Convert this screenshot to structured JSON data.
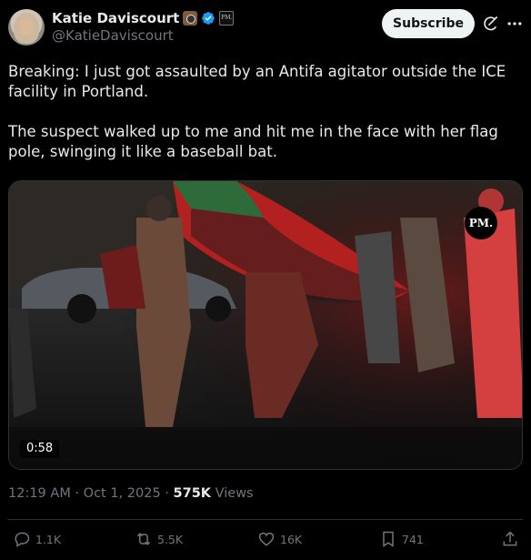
{
  "author": {
    "display_name": "Katie Daviscourt",
    "handle": "@KatieDaviscourt",
    "badges": [
      "camera-emoji-icon",
      "verified-icon",
      "pm-affiliate-icon"
    ],
    "affiliate_badge_text": "PM."
  },
  "header": {
    "subscribe_label": "Subscribe"
  },
  "tweet": {
    "paragraphs": [
      "Breaking: I just got assaulted by an Antifa agitator outside the ICE facility in Portland.",
      "The suspect walked up to me and hit me in the face with her flag pole, swinging it like a baseball bat."
    ]
  },
  "media": {
    "type": "video",
    "duration": "0:58",
    "watermark": "PM."
  },
  "meta": {
    "time": "12:19 AM",
    "separator": "·",
    "date": "Oct 1, 2025",
    "views_count": "575K",
    "views_label": "Views"
  },
  "actions": {
    "replies": "1.1K",
    "reposts": "5.5K",
    "likes": "16K",
    "bookmarks": "741"
  },
  "colors": {
    "background": "#000000",
    "text": "#e7e9ea",
    "muted": "#71767b",
    "verified": "#1d9bf0"
  }
}
